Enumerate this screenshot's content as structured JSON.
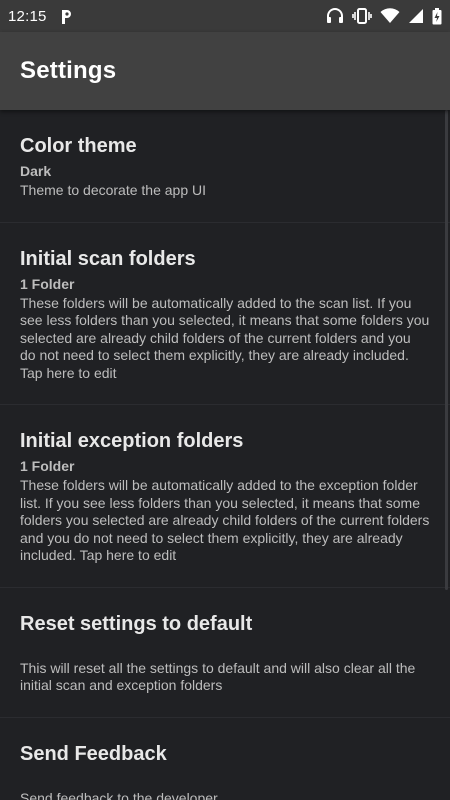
{
  "status_bar": {
    "time": "12:15",
    "icons": [
      "parking-icon",
      "headphones-icon",
      "vibrate-icon",
      "wifi-icon",
      "signal-icon",
      "battery-charging-icon"
    ]
  },
  "app_bar": {
    "title": "Settings"
  },
  "settings": [
    {
      "title": "Color theme",
      "value": "Dark",
      "description": "Theme to decorate the app UI"
    },
    {
      "title": "Initial scan folders",
      "value": "1 Folder",
      "description": "These folders will be automatically added to the scan list. If you see less folders than you selected, it means that some folders you selected are already child folders of the current folders and you do not need to select them explicitly, they are already included. Tap here to edit"
    },
    {
      "title": "Initial exception folders",
      "value": "1 Folder",
      "description": "These folders will be automatically added to the exception folder list. If you see less folders than you selected, it means that some folders you selected are already child folders of the current folders and you do not need to select them explicitly, they are already included. Tap here to edit"
    },
    {
      "title": "Reset settings to default",
      "description": "This will reset all the settings to default and will also clear all the initial scan and exception folders"
    },
    {
      "title": "Send Feedback",
      "description": "Send feedback to the developer"
    }
  ],
  "colors": {
    "background": "#202124",
    "app_bar": "#414141",
    "status_bar": "#3a3a3a",
    "title_text": "#e8e8e8",
    "secondary_text": "#bdbdbd"
  }
}
